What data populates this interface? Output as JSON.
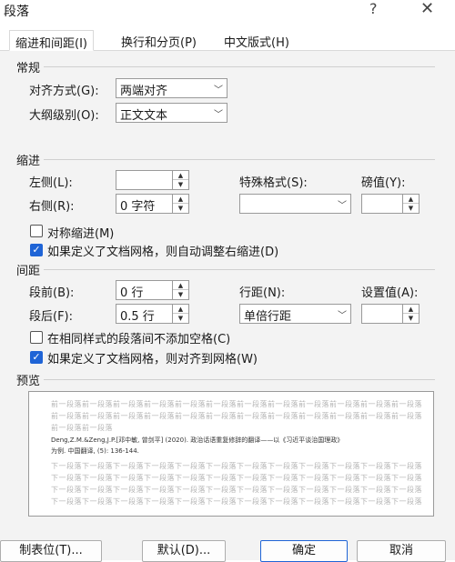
{
  "window": {
    "title": "段落",
    "help_icon": "?",
    "close_icon": "✕"
  },
  "tabs": [
    {
      "label": "缩进和间距(I)"
    },
    {
      "label": "换行和分页(P)"
    },
    {
      "label": "中文版式(H)"
    }
  ],
  "general": {
    "heading": "常规",
    "alignment": {
      "label": "对齐方式(G):",
      "value": "两端对齐"
    },
    "outline": {
      "label": "大纲级别(O):",
      "value": "正文文本"
    }
  },
  "indent": {
    "heading": "缩进",
    "left": {
      "label": "左侧(L):",
      "value": ""
    },
    "right": {
      "label": "右侧(R):",
      "value": "0 字符"
    },
    "special": {
      "label": "特殊格式(S):",
      "value": ""
    },
    "measure": {
      "label": "磅值(Y):",
      "value": ""
    },
    "mirror": {
      "label": "对称缩进(M)",
      "checked": false
    },
    "autogrid": {
      "label": "如果定义了文档网格，则自动调整右缩进(D)",
      "checked": true
    }
  },
  "spacing": {
    "heading": "间距",
    "before": {
      "label": "段前(B):",
      "value": "0 行"
    },
    "after": {
      "label": "段后(F):",
      "value": "0.5 行"
    },
    "line": {
      "label": "行距(N):",
      "value": "单倍行距"
    },
    "setting": {
      "label": "设置值(A):",
      "value": ""
    },
    "no_space": {
      "label": "在相同样式的段落间不添加空格(C)",
      "checked": false
    },
    "snap": {
      "label": "如果定义了文档网格，则对齐到网格(W)",
      "checked": true
    }
  },
  "preview": {
    "heading": "预览",
    "prev_line1": "前一段落前一段落前一段落前一段落前一段落前一段落前一段落前一段落前一段落前一段落前一段落前一段落",
    "prev_line2": "前一段落前一段落前一段落前一段落前一段落前一段落前一段落前一段落前一段落前一段落前一段落前一段落",
    "prev_line3": "前一段落前一段落",
    "sample_line1": "Deng,Z.M.&Zeng,J.P.[邓中敏, 曾剑平] (2020). 政治话语重复修辞的翻译——以《习近平谈治国理政》",
    "sample_line2": "为例. 中国翻译, (5): 136-144.",
    "next_line1": "下一段落下一段落下一段落下一段落下一段落下一段落下一段落下一段落下一段落下一段落下一段落下一段落",
    "next_line2": "下一段落下一段落下一段落下一段落下一段落下一段落下一段落下一段落下一段落下一段落下一段落下一段落",
    "next_line3": "下一段落下一段落下一段落下一段落下一段落下一段落下一段落下一段落下一段落下一段落下一段落下一段落",
    "next_line4": "下一段落下一段落下一段落下一段落下一段落下一段落下一段落下一段落下一段落下一段落下一段落下一段落"
  },
  "buttons": {
    "tabs": "制表位(T)...",
    "default": "默认(D)...",
    "ok": "确定",
    "cancel": "取消"
  },
  "icons": {
    "chevron": "﹀",
    "spin_up": "▲",
    "spin_down": "▼",
    "check": "✓"
  },
  "colors": {
    "accent": "#1f64d6",
    "panel": "#f3f3f3"
  }
}
